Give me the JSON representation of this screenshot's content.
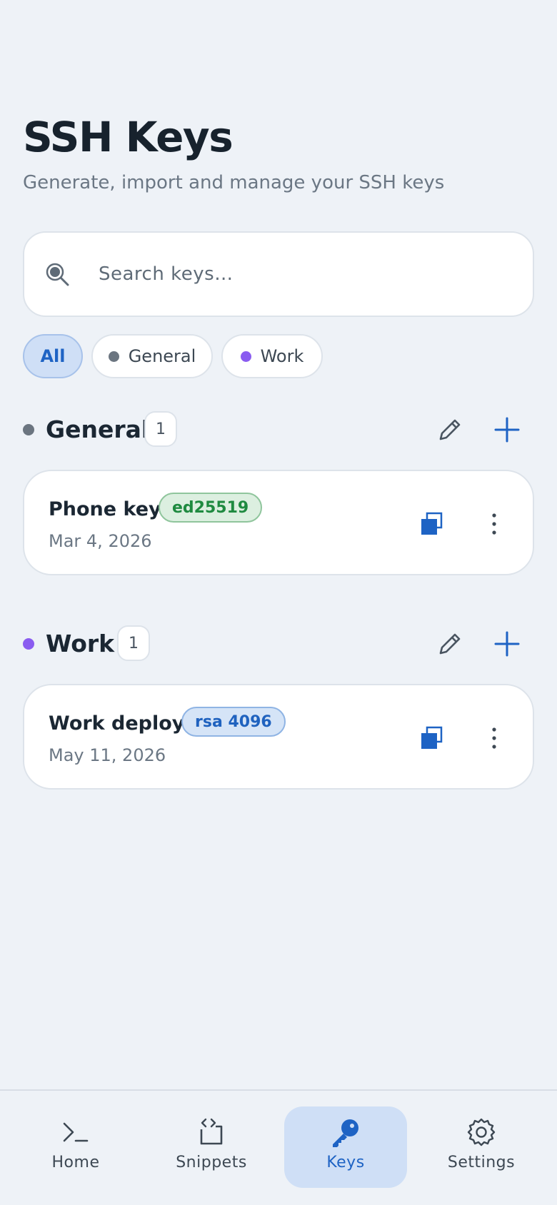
{
  "header": {
    "title": "SSH Keys",
    "subtitle": "Generate, import and manage your SSH keys"
  },
  "search": {
    "placeholder": "Search keys…",
    "value": "",
    "icon": "search-icon"
  },
  "filters": [
    {
      "label": "All",
      "active": true
    },
    {
      "label": "General",
      "active": false,
      "dot_color": "#6b7580"
    },
    {
      "label": "Work",
      "active": false,
      "dot_color": "#8a5cf0"
    }
  ],
  "groups": [
    {
      "name": "General",
      "count": "1",
      "dot_color": "#6b7580",
      "keys": [
        {
          "name": "Phone key",
          "type": "ed25519",
          "date": "Mar 4, 2026"
        }
      ]
    },
    {
      "name": "Work",
      "count": "1",
      "dot_color": "#8a5cf0",
      "keys": [
        {
          "name": "Work deploy",
          "type": "rsa 4096",
          "date": "May 11, 2026"
        }
      ]
    }
  ],
  "nav": {
    "items": [
      {
        "label": "Home",
        "icon": "terminal-icon",
        "active": false
      },
      {
        "label": "Snippets",
        "icon": "code-snippet-icon",
        "active": false
      },
      {
        "label": "Keys",
        "icon": "key-icon",
        "active": true
      },
      {
        "label": "Settings",
        "icon": "gear-icon",
        "active": false
      }
    ]
  },
  "colors": {
    "accent": "#1e63c4",
    "background": "#eef2f7",
    "ed25519_badge": "#1f8a40",
    "rsa_badge": "#1f62bf"
  }
}
